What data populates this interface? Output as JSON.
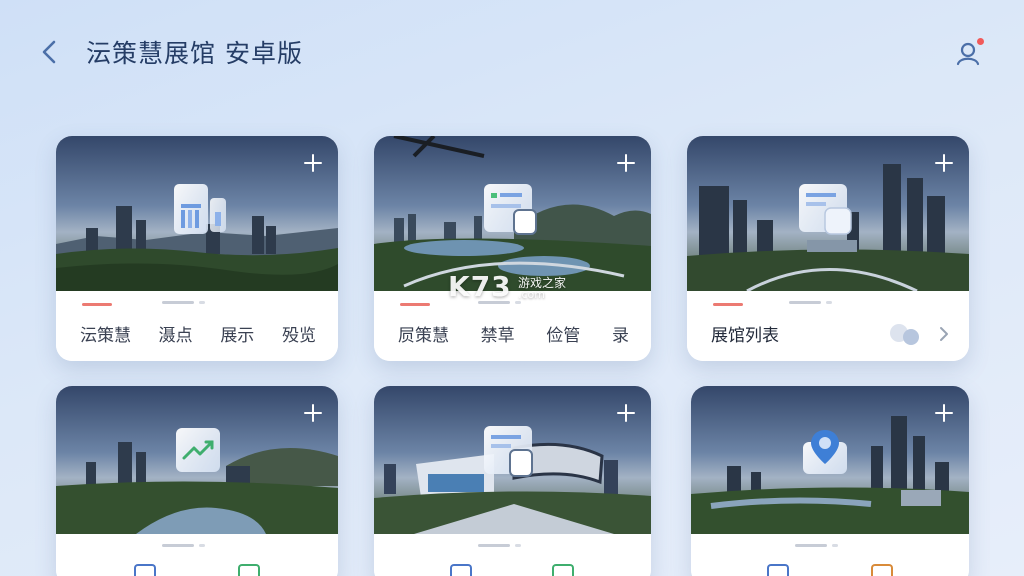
{
  "header": {
    "title": "沄策慧展馆 安卓版",
    "back_icon": "chevron-left-icon",
    "user_icon": "user-icon"
  },
  "colors": {
    "background": "#dce8f8",
    "accent_red": "#ec7a72",
    "title": "#253d66"
  },
  "cards": [
    {
      "labels": [
        "沄策慧",
        "滠点",
        "展示",
        "殁览"
      ],
      "feature_icon": "document-bars-icon",
      "action_icon": "plus-icon"
    },
    {
      "labels": [
        "屃策慧",
        "禁草",
        "俭管",
        "录"
      ],
      "feature_icon": "document-list-icon",
      "action_icon": "plus-icon"
    },
    {
      "label": "展馆列表",
      "feature_icon": "document-list-icon",
      "action_icon": "plus-icon",
      "toggle_icon": "toggle-icon",
      "chevron_icon": "chevron-right-icon"
    },
    {
      "feature_icon": "trend-chart-icon",
      "action_icon": "plus-icon"
    },
    {
      "feature_icon": "document-list-icon",
      "action_icon": "plus-icon"
    },
    {
      "feature_icon": "location-pin-icon",
      "action_icon": "plus-icon"
    }
  ],
  "watermark": {
    "main": "K73",
    "line1": "游戏之家",
    "line2": ".com"
  }
}
